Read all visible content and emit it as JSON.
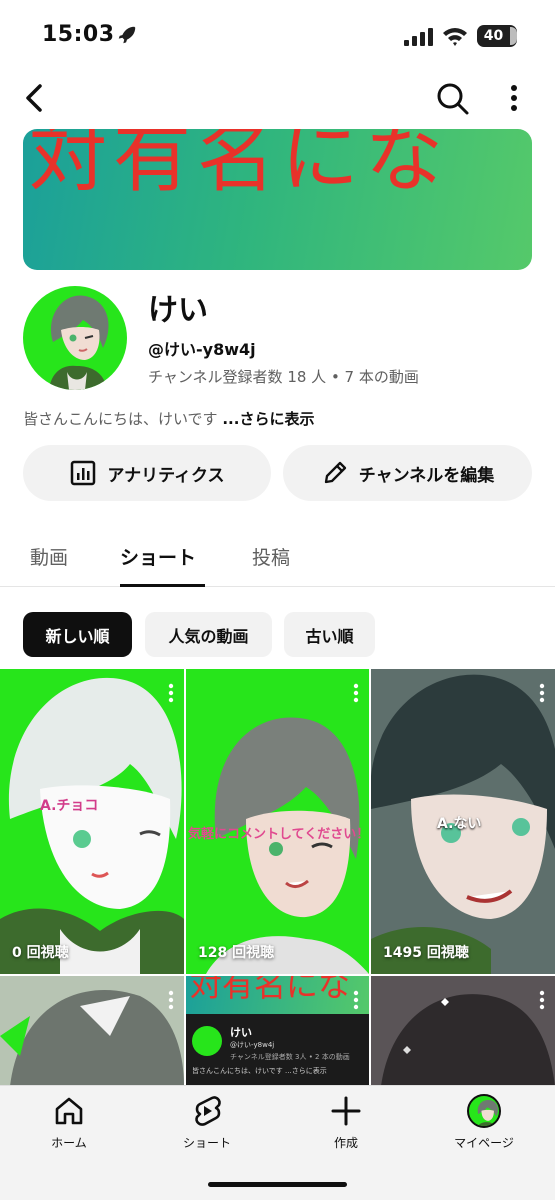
{
  "status_bar": {
    "time": "15:03",
    "battery": "40"
  },
  "top_bar": {
    "back_icon": "chevron-left-icon",
    "search_icon": "search-icon",
    "more_icon": "vertical-dots-icon"
  },
  "banner": {
    "text": "対有名にな"
  },
  "channel": {
    "name": "けい",
    "handle": "@けい-y8w4j",
    "meta": "チャンネル登録者数 18 人 • 7 本の動画",
    "description": "皆さんこんにちは、けいです",
    "more_link": "...さらに表示"
  },
  "buttons": {
    "analytics": "アナリティクス",
    "edit_channel": "チャンネルを編集"
  },
  "tabs": [
    {
      "label": "動画",
      "active": false
    },
    {
      "label": "ショート",
      "active": true
    },
    {
      "label": "投稿",
      "active": false
    }
  ],
  "chips": [
    {
      "label": "新しい順",
      "active": true
    },
    {
      "label": "人気の動画",
      "active": false
    },
    {
      "label": "古い順",
      "active": false
    }
  ],
  "shorts": [
    {
      "views": "0 回視聴",
      "caption": "A.チョコ"
    },
    {
      "views": "128 回視聴",
      "caption": "気軽にコメントしてください！"
    },
    {
      "views": "1495 回視聴",
      "caption": "A.ない"
    },
    {
      "views": "",
      "caption": ""
    },
    {
      "views": "",
      "caption": "",
      "thumb_name": "けい",
      "thumb_handle": "@けい-y8w4j",
      "thumb_meta": "チャンネル登録者数 3人 • 2 本の動画",
      "thumb_desc": "皆さんこんにちは、けいです ...さらに表示",
      "thumb_banner": "対有名にな"
    },
    {
      "views": "",
      "caption": ""
    }
  ],
  "bottom_nav": [
    {
      "label": "ホーム",
      "icon": "home-icon"
    },
    {
      "label": "ショート",
      "icon": "shorts-icon"
    },
    {
      "label": "作成",
      "icon": "plus-icon"
    },
    {
      "label": "マイページ",
      "icon": "avatar"
    }
  ],
  "colors": {
    "accent_green": "#27e51b",
    "banner_red": "#e8322a",
    "chip_active": "#0f0f0f"
  }
}
